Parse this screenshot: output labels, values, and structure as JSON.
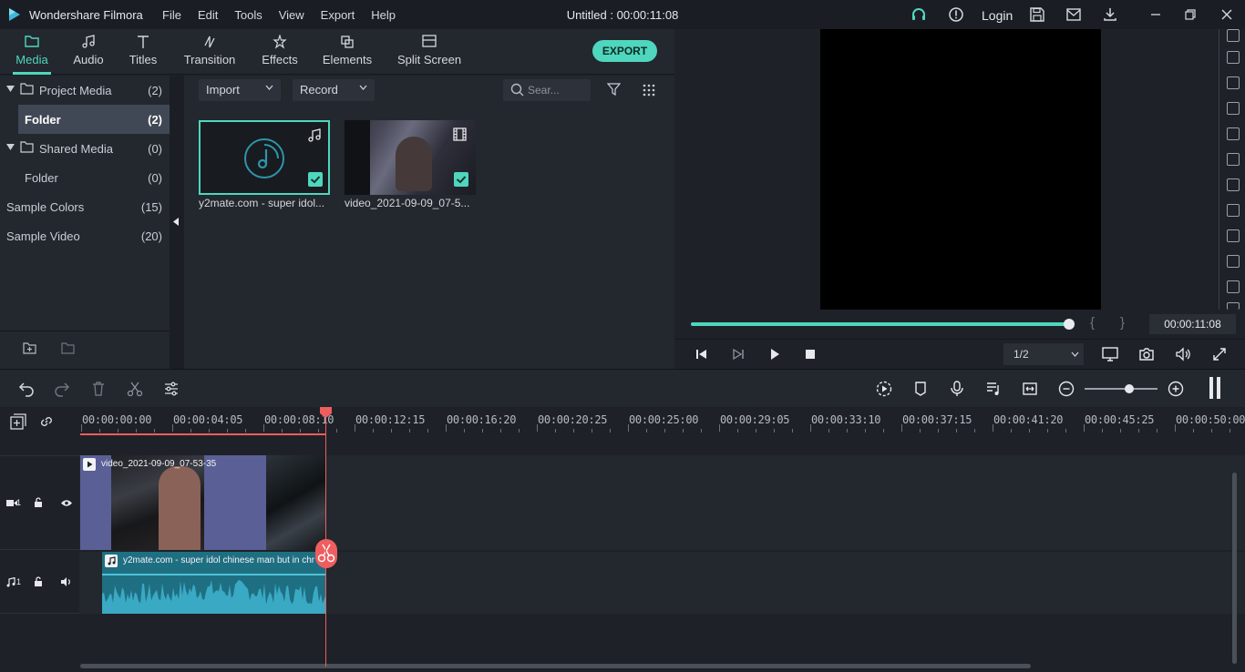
{
  "app": {
    "name": "Wondershare Filmora",
    "menu": [
      "File",
      "Edit",
      "Tools",
      "View",
      "Export",
      "Help"
    ],
    "title": "Untitled : 00:00:11:08",
    "login": "Login"
  },
  "tabs": [
    {
      "label": "Media",
      "icon": "folder-icon",
      "active": true
    },
    {
      "label": "Audio",
      "icon": "music-note-icon"
    },
    {
      "label": "Titles",
      "icon": "text-t-icon"
    },
    {
      "label": "Transition",
      "icon": "transition-icon"
    },
    {
      "label": "Effects",
      "icon": "effects-icon"
    },
    {
      "label": "Elements",
      "icon": "elements-icon"
    },
    {
      "label": "Split Screen",
      "icon": "split-screen-icon"
    }
  ],
  "export_label": "EXPORT",
  "library": {
    "items": [
      {
        "name": "Project Media",
        "count": "(2)"
      },
      {
        "name": "Folder",
        "count": "(2)"
      },
      {
        "name": "Shared Media",
        "count": "(0)"
      },
      {
        "name": "Folder",
        "count": "(0)"
      },
      {
        "name": "Sample Colors",
        "count": "(15)"
      },
      {
        "name": "Sample Video",
        "count": "(20)"
      }
    ]
  },
  "media": {
    "import_label": "Import",
    "record_label": "Record",
    "search_placeholder": "Sear...",
    "items": [
      {
        "name": "y2mate.com - super idol...",
        "type": "audio"
      },
      {
        "name": "video_2021-09-09_07-5...",
        "type": "video"
      }
    ]
  },
  "preview": {
    "timecode": "00:00:11:08",
    "ratio": "1/2",
    "progress": 1.0,
    "bracket_in": "{",
    "bracket_out": "}"
  },
  "timeline": {
    "ruler": [
      "00:00:00:00",
      "00:00:04:05",
      "00:00:08:10",
      "00:00:12:15",
      "00:00:16:20",
      "00:00:20:25",
      "00:00:25:00",
      "00:00:29:05",
      "00:00:33:10",
      "00:00:37:15",
      "00:00:41:20",
      "00:00:45:25",
      "00:00:50:00"
    ],
    "video_track_label": "1",
    "audio_track_label": "1",
    "video_clip": "video_2021-09-09_07-53-35",
    "audio_clip": "y2mate.com - super idol chinese man but in chr"
  },
  "colors": {
    "accent": "#4fd6be",
    "playhead": "#ef5e5e",
    "video_clip": "#5a5f96",
    "audio_clip": "#2b8fa6"
  }
}
